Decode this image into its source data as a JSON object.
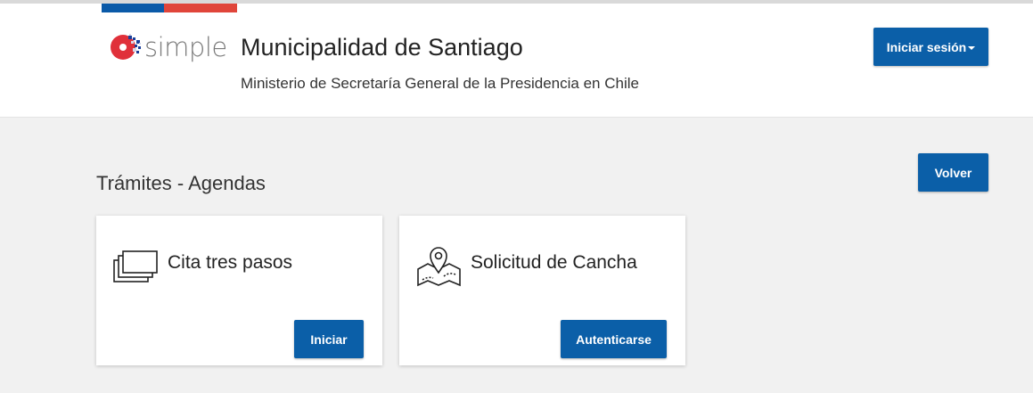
{
  "header": {
    "logo_text": "simple",
    "org_title": "Municipalidad de Santiago",
    "org_subtitle": "Ministerio de Secretaría General de la Presidencia en Chile",
    "login_label": "Iniciar sesión"
  },
  "main": {
    "section_title": "Trámites - Agendas",
    "back_label": "Volver",
    "cards": [
      {
        "title": "Cita tres pasos",
        "icon": "stacked-pages-icon",
        "button_label": "Iniciar"
      },
      {
        "title": "Solicitud de Cancha",
        "icon": "map-pin-icon",
        "button_label": "Autenticarse"
      }
    ]
  },
  "colors": {
    "primary": "#0b5fa8",
    "flag_blue": "#0a5aa8",
    "flag_red": "#e0453a",
    "background": "#f1f1f1"
  }
}
